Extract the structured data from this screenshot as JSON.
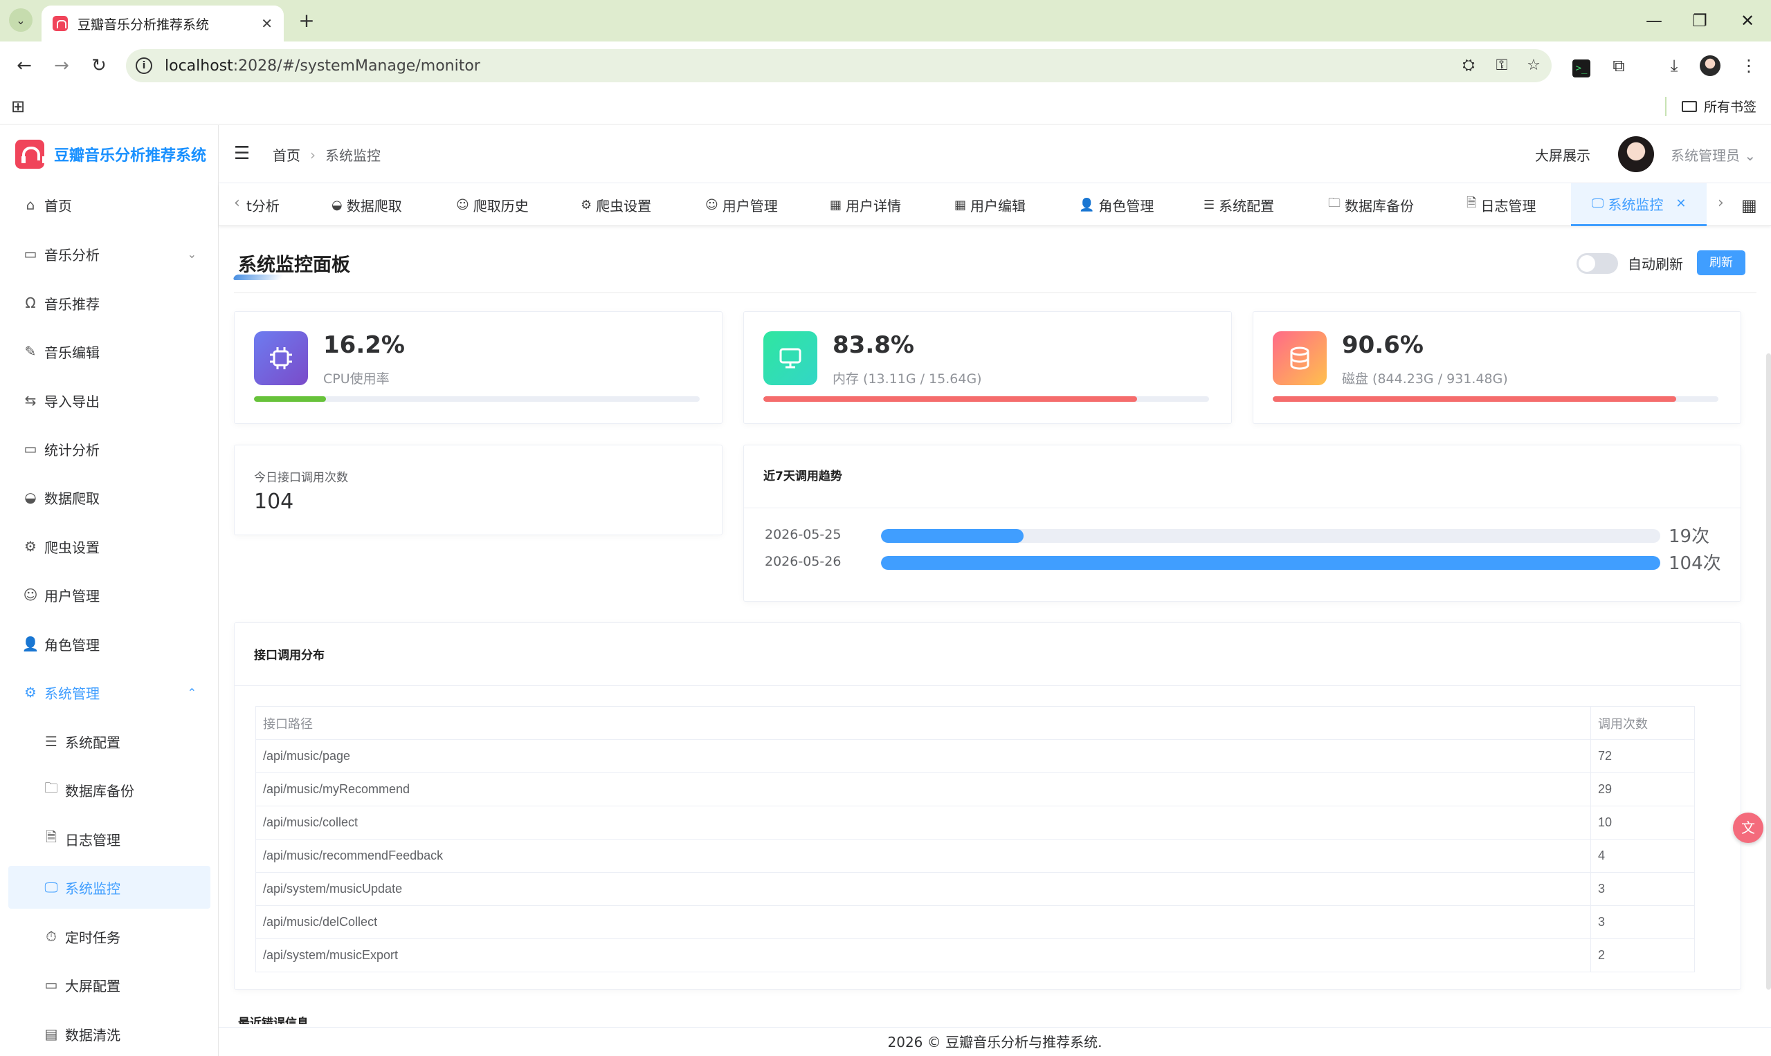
{
  "browser": {
    "tab_title": "豆瓣音乐分析推荐系统",
    "url_host": "localhost",
    "url_path": ":2028/#/systemManage/monitor",
    "bookmarks_label": "所有书签"
  },
  "sidebar": {
    "logo_text": "豆瓣音乐分析推荐系统",
    "items": [
      {
        "label": "首页",
        "icon": "home-icon"
      },
      {
        "label": "音乐分析",
        "icon": "chart-board-icon"
      },
      {
        "label": "音乐推荐",
        "icon": "headphones-icon"
      },
      {
        "label": "音乐编辑",
        "icon": "edit-pen-icon"
      },
      {
        "label": "导入导出",
        "icon": "switch-arrows-icon"
      },
      {
        "label": "统计分析",
        "icon": "chart-board-icon"
      },
      {
        "label": "数据爬取",
        "icon": "bowl-icon"
      },
      {
        "label": "爬虫设置",
        "icon": "gear-icon"
      },
      {
        "label": "用户管理",
        "icon": "user-icon"
      },
      {
        "label": "角色管理",
        "icon": "user-filled-icon"
      },
      {
        "label": "系统管理",
        "icon": "gear-icon"
      }
    ],
    "sub_items": [
      {
        "label": "系统配置",
        "icon": "sliders-icon"
      },
      {
        "label": "数据库备份",
        "icon": "folder-icon"
      },
      {
        "label": "日志管理",
        "icon": "document-icon"
      },
      {
        "label": "系统监控",
        "icon": "monitor-icon"
      },
      {
        "label": "定时任务",
        "icon": "timer-icon"
      },
      {
        "label": "大屏配置",
        "icon": "screen-icon"
      },
      {
        "label": "数据清洗",
        "icon": "box-icon"
      }
    ]
  },
  "header": {
    "breadcrumb_home": "首页",
    "breadcrumb_current": "系统监控",
    "bigscreen": "大屏展示",
    "username": "系统管理员"
  },
  "tags": [
    {
      "label": "t分析",
      "icon": ""
    },
    {
      "label": "数据爬取",
      "icon": "bowl-icon"
    },
    {
      "label": "爬取历史",
      "icon": "user-icon"
    },
    {
      "label": "爬虫设置",
      "icon": "gear-icon"
    },
    {
      "label": "用户管理",
      "icon": "user-icon"
    },
    {
      "label": "用户详情",
      "icon": "grid-icon"
    },
    {
      "label": "用户编辑",
      "icon": "grid-icon"
    },
    {
      "label": "角色管理",
      "icon": "user-filled-icon"
    },
    {
      "label": "系统配置",
      "icon": "sliders-icon"
    },
    {
      "label": "数据库备份",
      "icon": "folder-icon"
    },
    {
      "label": "日志管理",
      "icon": "document-icon"
    },
    {
      "label": "系统监控",
      "icon": "monitor-icon"
    }
  ],
  "panel": {
    "title": "系统监控面板",
    "auto_refresh_label": "自动刷新",
    "auto_refresh_on": false,
    "refresh_label": "刷新"
  },
  "metrics": {
    "cpu": {
      "value": "16.2%",
      "label": "CPU使用率",
      "percent": 16.2,
      "color": "#67c23a"
    },
    "memory": {
      "value": "83.8%",
      "label": "内存 (13.11G / 15.64G)",
      "percent": 83.8,
      "color": "#f56c6c"
    },
    "disk": {
      "value": "90.6%",
      "label": "磁盘 (844.23G / 931.48G)",
      "percent": 90.6,
      "color": "#f56c6c"
    }
  },
  "today_calls": {
    "label": "今日接口调用次数",
    "value": "104"
  },
  "trend": {
    "title": "近7天调用趋势",
    "max": 104,
    "rows": [
      {
        "date": "2026-05-25",
        "count": 19,
        "count_label": "19次"
      },
      {
        "date": "2026-05-26",
        "count": 104,
        "count_label": "104次"
      }
    ]
  },
  "api_distribution": {
    "title": "接口调用分布",
    "columns": [
      "接口路径",
      "调用次数"
    ],
    "rows": [
      [
        "/api/music/page",
        "72"
      ],
      [
        "/api/music/myRecommend",
        "29"
      ],
      [
        "/api/music/collect",
        "10"
      ],
      [
        "/api/music/recommendFeedback",
        "4"
      ],
      [
        "/api/system/musicUpdate",
        "3"
      ],
      [
        "/api/music/delCollect",
        "3"
      ],
      [
        "/api/system/musicExport",
        "2"
      ]
    ]
  },
  "errors_title": "最近错误信息",
  "footer": "2026 © 豆瓣音乐分析与推荐系统."
}
